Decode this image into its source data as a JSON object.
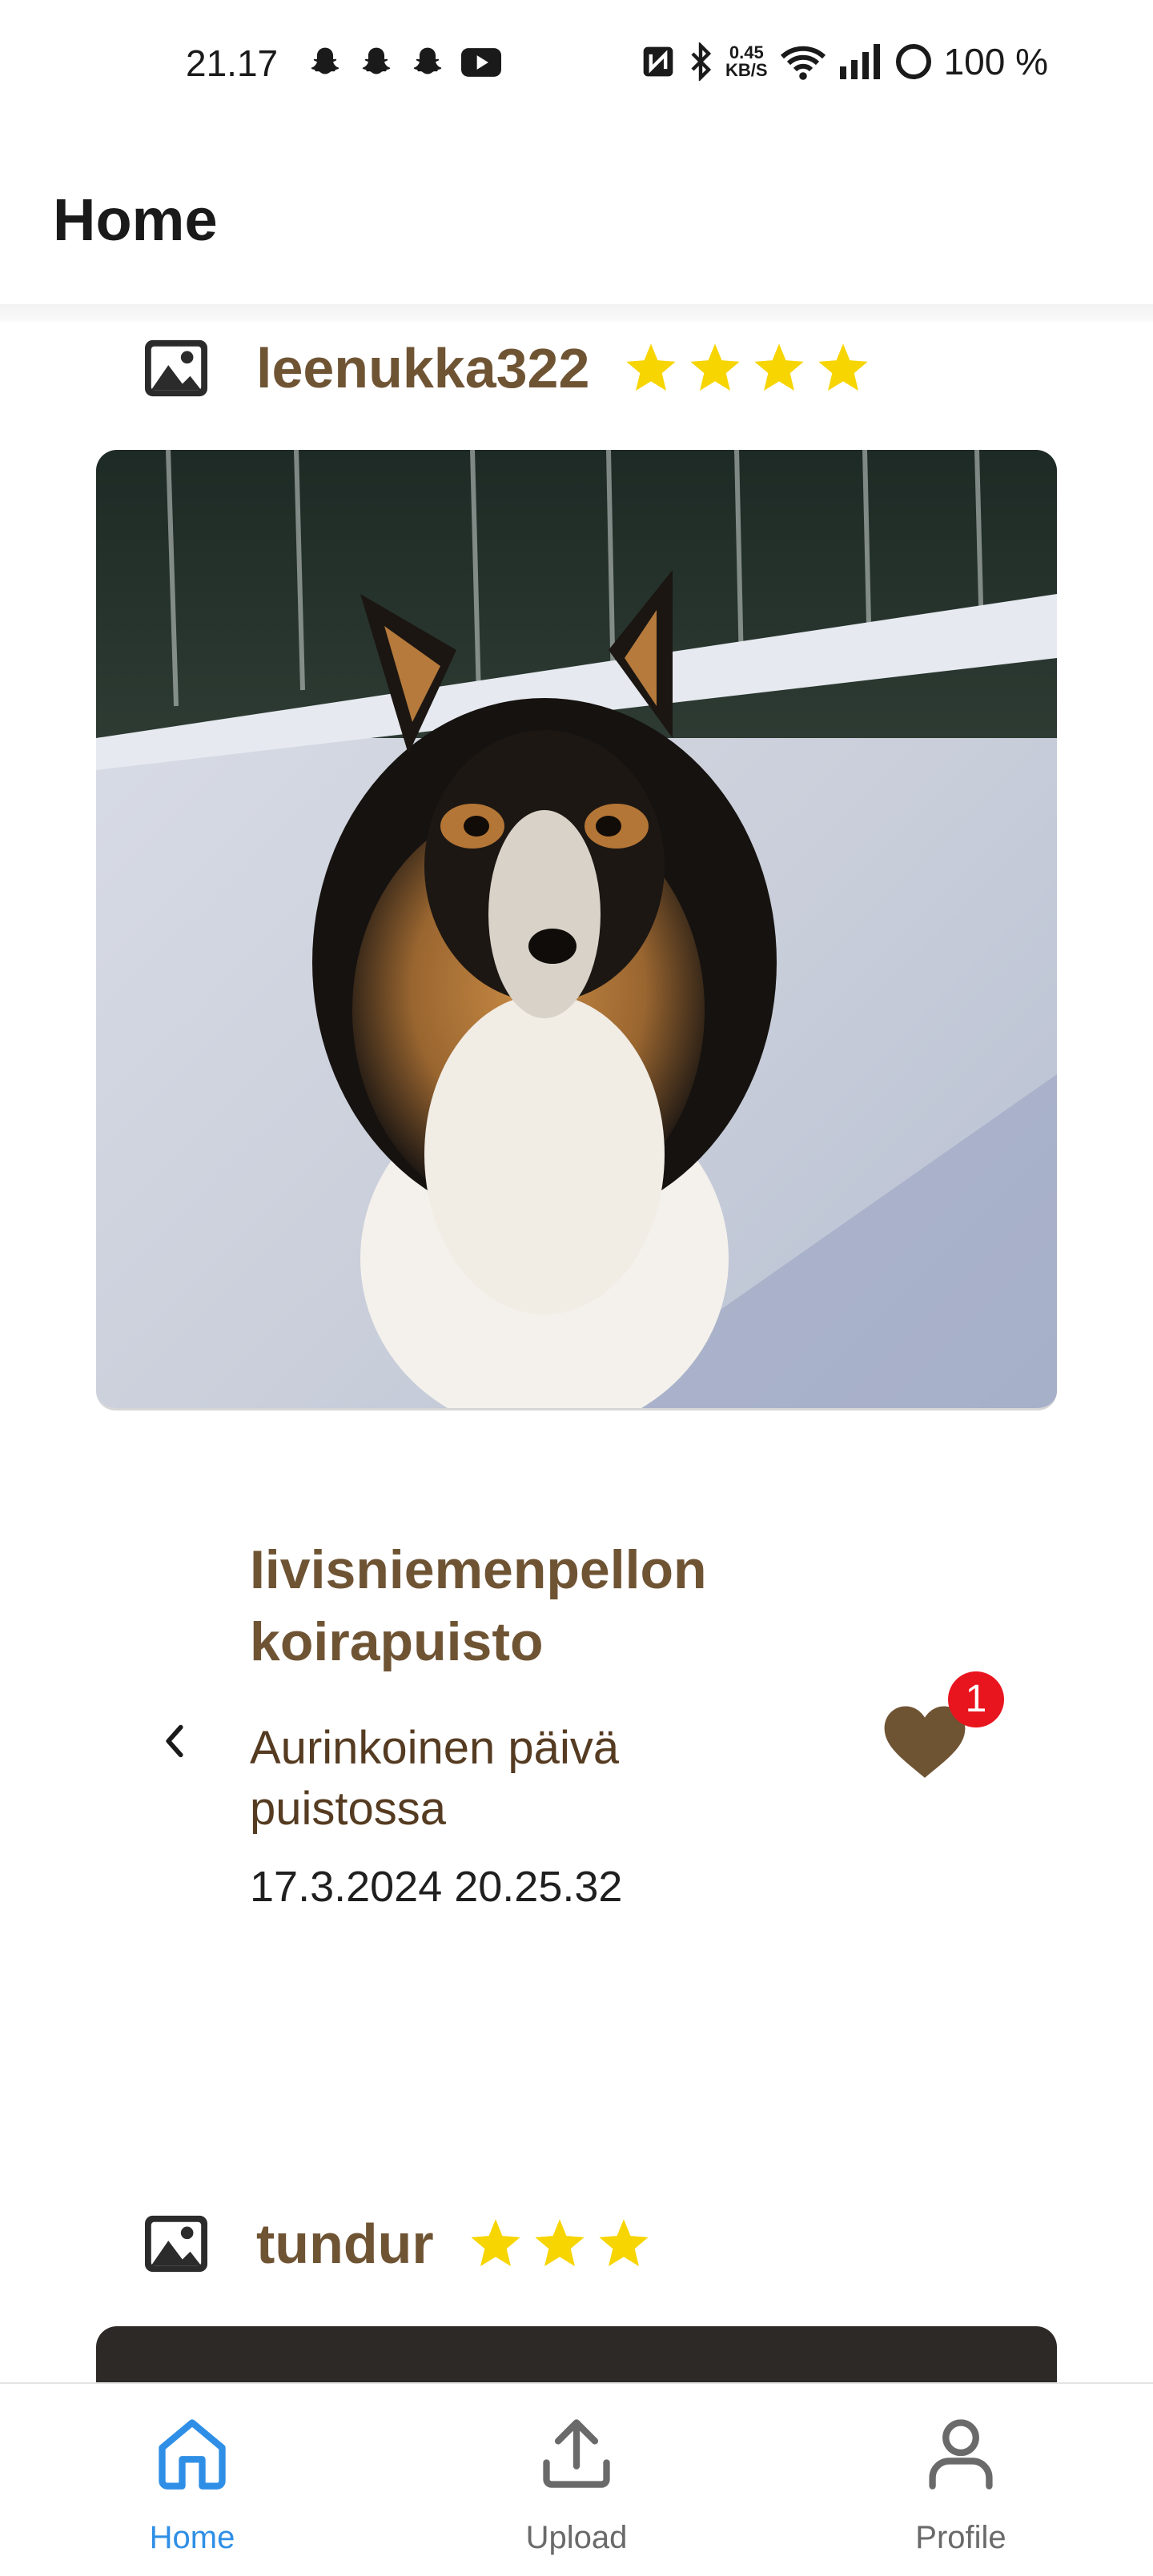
{
  "status_bar": {
    "time": "21.17",
    "notifications": [
      "snapchat-icon",
      "snapchat-icon",
      "snapchat-icon",
      "youtube-icon"
    ],
    "nfc": "nfc-icon",
    "bluetooth": "bluetooth-icon",
    "speed_value": "0.45",
    "speed_unit": "KB/S",
    "battery": "100 %"
  },
  "header": {
    "title": "Home"
  },
  "posts": [
    {
      "username": "leenukka322",
      "rating": 4,
      "photo": "collie dog on snow",
      "title_line1": "Iivisniemenpellon",
      "title_line2": "koirapuisto",
      "desc_line1": "Aurinkoinen päivä",
      "desc_line2": "puistossa",
      "date": "17.3.2024 20.25.32",
      "likes": "1"
    },
    {
      "username": "tundur",
      "rating": 3
    }
  ],
  "nav": {
    "items": [
      {
        "label": "Home",
        "icon": "home-icon",
        "active": true
      },
      {
        "label": "Upload",
        "icon": "upload-icon",
        "active": false
      },
      {
        "label": "Profile",
        "icon": "profile-icon",
        "active": false
      }
    ]
  },
  "colors": {
    "brand_brown": "#6f5434",
    "star": "#f7d500",
    "active_nav": "#2f8fe6",
    "inactive_nav": "#6a6a6a",
    "badge": "#e8141e"
  }
}
